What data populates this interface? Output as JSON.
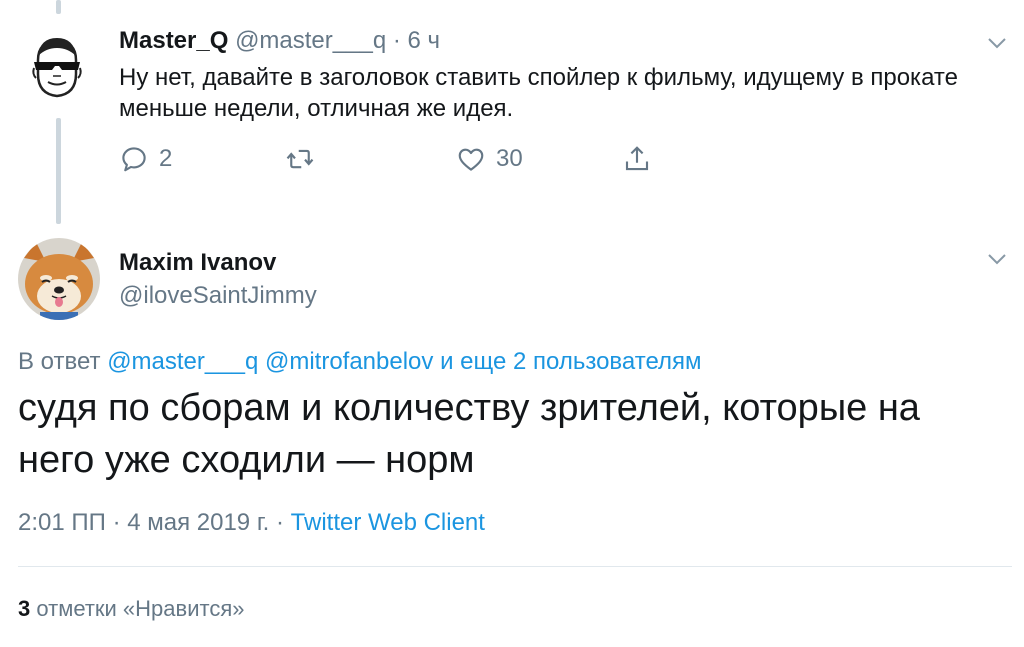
{
  "parent_tweet": {
    "name": "Master_Q",
    "handle": "@master___q",
    "separator": "·",
    "time": "6 ч",
    "text": "Ну нет, давайте в заголовок ставить спойлер к фильму, идущему в прокате меньше недели, отличная же идея.",
    "actions": {
      "reply_count": "2",
      "retweet_count": "",
      "like_count": "30"
    }
  },
  "main_tweet": {
    "name": "Maxim Ivanov",
    "handle": "@iloveSaintJimmy",
    "reply_to": {
      "prefix": "В ответ",
      "handle_1": "@master___q",
      "handle_2": "@mitrofanbelov",
      "others": "и еще 2 пользователям"
    },
    "text": "судя по сборам и количеству зрителей, которые на него уже сходили — норм",
    "meta": {
      "time": "2:01 ПП",
      "separator_1": "·",
      "date": "4 мая 2019 г.",
      "separator_2": "·",
      "client": "Twitter Web Client"
    },
    "likes": {
      "count": "3",
      "label": "отметки «Нравится»"
    }
  },
  "icons": [
    "avatar-master-q",
    "avatar-dog",
    "chevron-down-icon",
    "reply-icon",
    "retweet-icon",
    "like-icon",
    "share-icon"
  ],
  "colors": {
    "text": "#14171a",
    "secondary": "#657786",
    "link": "#1b95e0",
    "thread_line": "#ccd6dd",
    "divider": "#e1e8ed"
  }
}
